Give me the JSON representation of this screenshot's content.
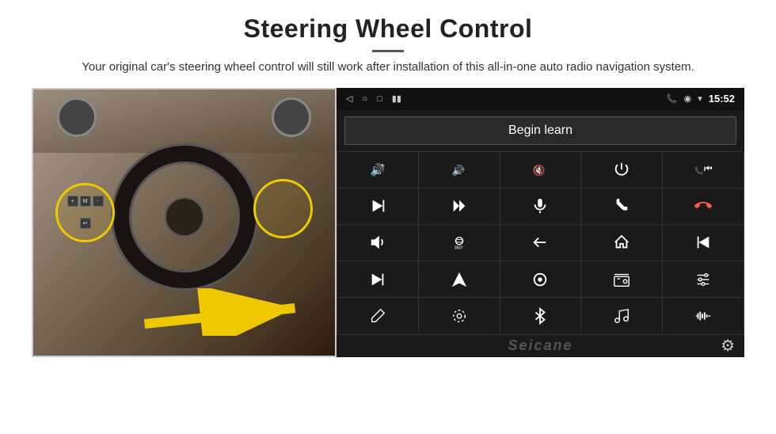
{
  "header": {
    "title": "Steering Wheel Control",
    "subtitle": "Your original car's steering wheel control will still work after installation of this all-in-one auto radio navigation system."
  },
  "status_bar": {
    "time": "15:52",
    "icons": [
      "phone",
      "location",
      "wifi",
      "battery"
    ]
  },
  "begin_learn": {
    "label": "Begin learn"
  },
  "controls": [
    {
      "icon": "vol_up",
      "symbol": "🔊+",
      "svg_type": "vol-up"
    },
    {
      "icon": "vol_down",
      "symbol": "🔊-",
      "svg_type": "vol-down"
    },
    {
      "icon": "mute",
      "symbol": "🔇",
      "svg_type": "mute"
    },
    {
      "icon": "power",
      "symbol": "⏻",
      "svg_type": "power"
    },
    {
      "icon": "phone_prev",
      "symbol": "📞⏮",
      "svg_type": "phone-prev"
    },
    {
      "icon": "next",
      "symbol": "⏭",
      "svg_type": "next"
    },
    {
      "icon": "seek_next",
      "symbol": "⏩",
      "svg_type": "seek-next"
    },
    {
      "icon": "mic",
      "symbol": "🎤",
      "svg_type": "mic"
    },
    {
      "icon": "phone",
      "symbol": "📞",
      "svg_type": "phone"
    },
    {
      "icon": "hang_up",
      "symbol": "📵",
      "svg_type": "hang-up"
    },
    {
      "icon": "speaker",
      "symbol": "📢",
      "svg_type": "speaker"
    },
    {
      "icon": "360",
      "symbol": "360°",
      "svg_type": "360"
    },
    {
      "icon": "back",
      "symbol": "↩",
      "svg_type": "back"
    },
    {
      "icon": "home",
      "symbol": "⌂",
      "svg_type": "home"
    },
    {
      "icon": "skip_back",
      "symbol": "⏮⏮",
      "svg_type": "skip-back"
    },
    {
      "icon": "fast_fwd",
      "symbol": "⏭",
      "svg_type": "fast-fwd"
    },
    {
      "icon": "nav",
      "symbol": "▲",
      "svg_type": "nav"
    },
    {
      "icon": "source",
      "symbol": "⊜",
      "svg_type": "source"
    },
    {
      "icon": "radio",
      "symbol": "📻",
      "svg_type": "radio"
    },
    {
      "icon": "eq",
      "symbol": "🎚",
      "svg_type": "eq"
    },
    {
      "icon": "pen",
      "symbol": "✏",
      "svg_type": "pen"
    },
    {
      "icon": "settings2",
      "symbol": "⚙",
      "svg_type": "settings2"
    },
    {
      "icon": "bluetooth",
      "symbol": "⚡",
      "svg_type": "bluetooth"
    },
    {
      "icon": "music",
      "symbol": "♪",
      "svg_type": "music"
    },
    {
      "icon": "waveform",
      "symbol": "〰",
      "svg_type": "waveform"
    }
  ],
  "watermark": {
    "text": "Seicane"
  },
  "gear": {
    "symbol": "⚙"
  }
}
